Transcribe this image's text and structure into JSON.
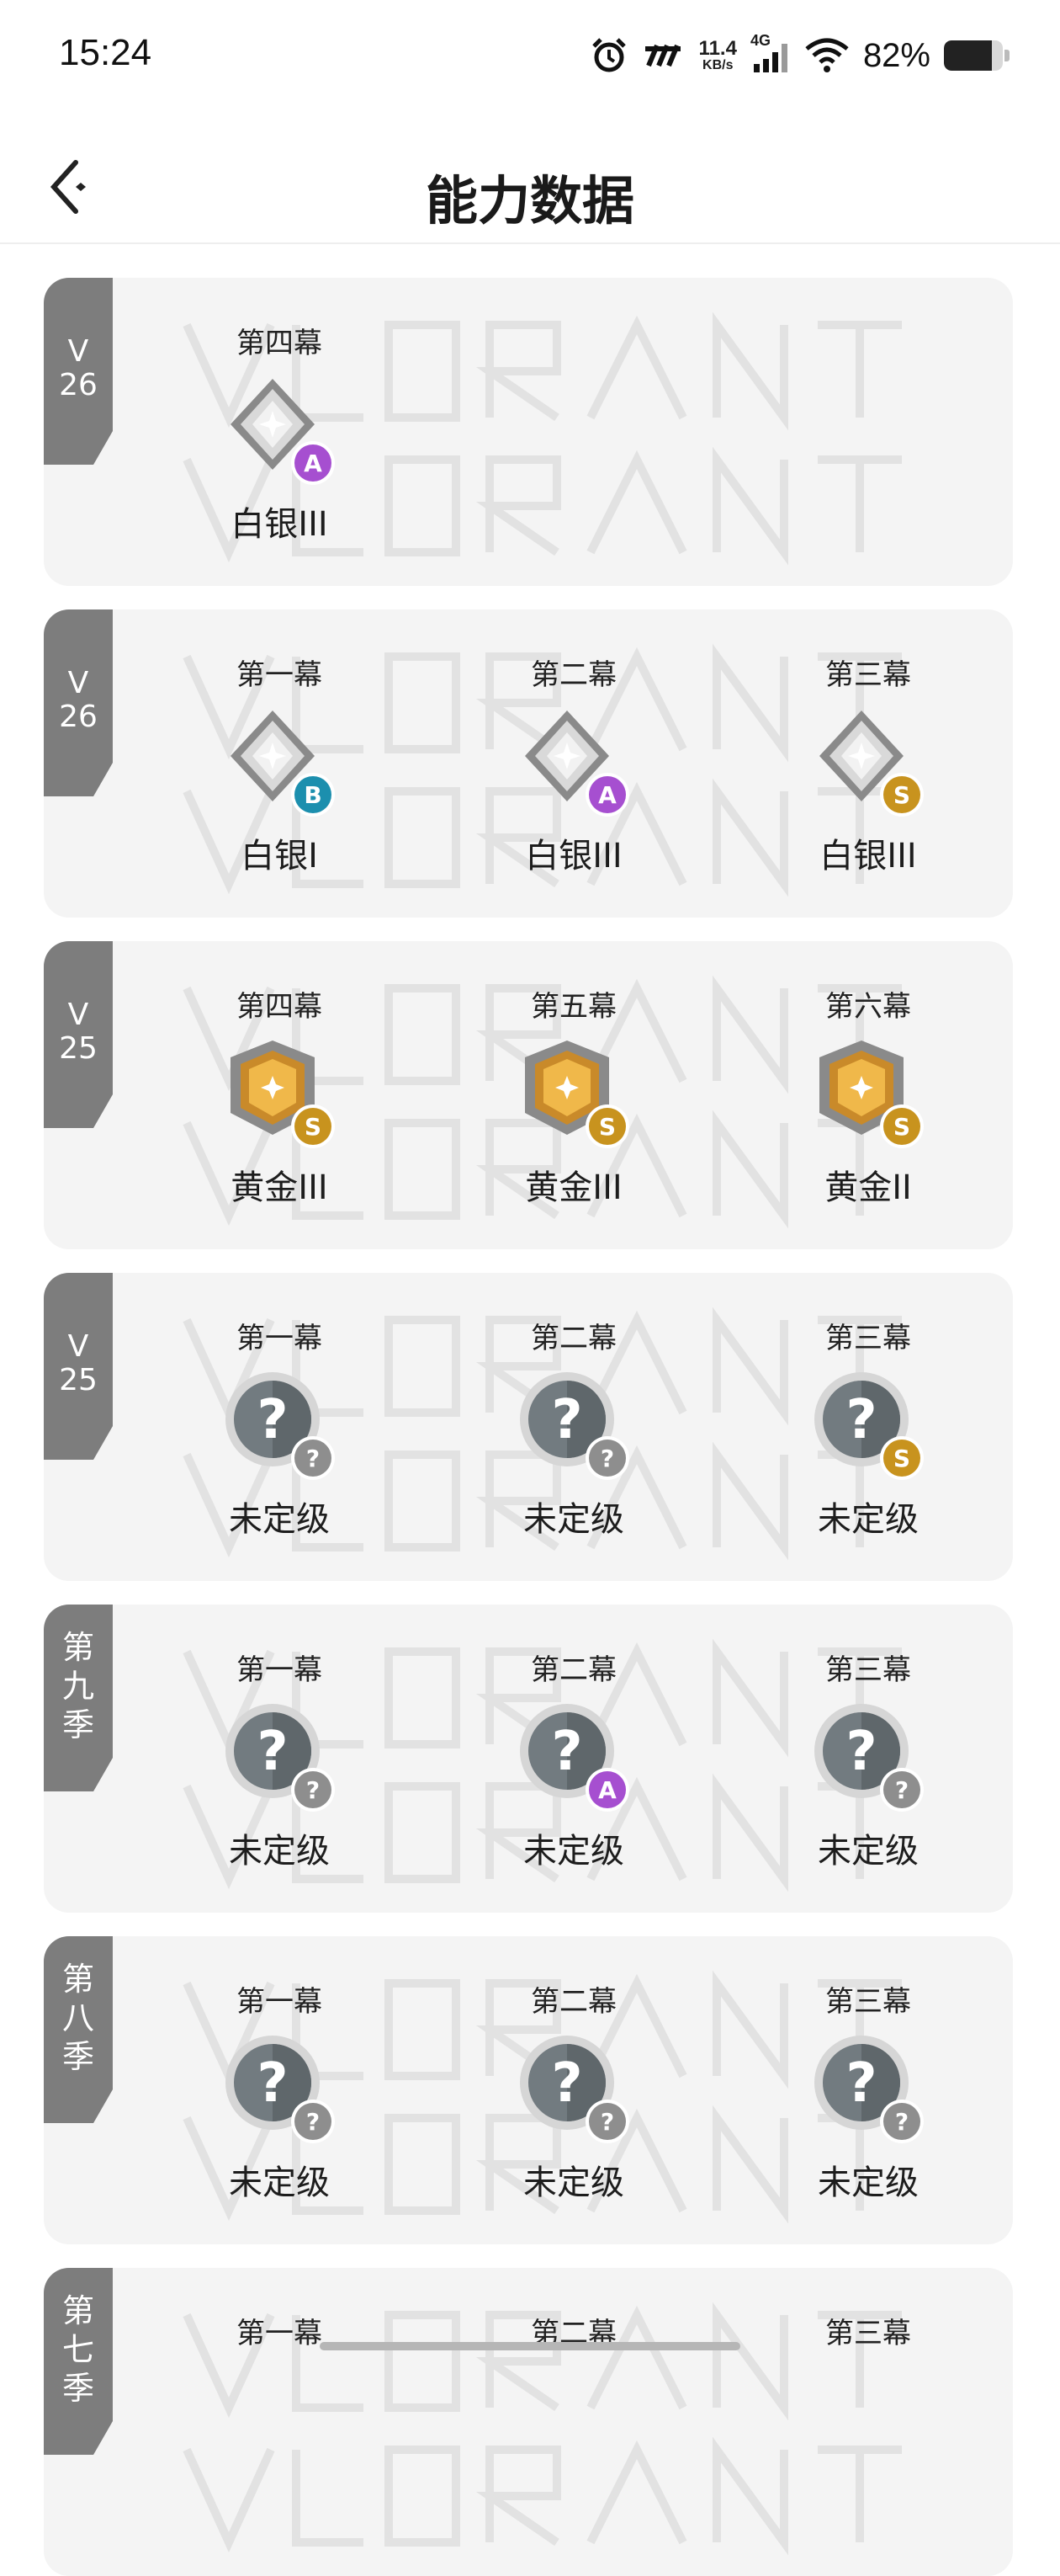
{
  "status_bar": {
    "time": "15:24",
    "network_speed": "11.4",
    "network_unit": "KB/s",
    "signal_label": "4G",
    "battery_percent": "82%",
    "battery_level": 0.82,
    "icons": [
      "alarm-icon",
      "app-notification-icon",
      "signal-icon",
      "wifi-icon",
      "battery-icon"
    ]
  },
  "header": {
    "title": "能力数据",
    "back_icon": "back-arrow-icon"
  },
  "colors": {
    "tag_bg": "#7d7d7d",
    "card_bg": "#f4f4f4",
    "badge_A": "#a64fd0",
    "badge_B": "#1c8fae",
    "badge_S": "#c8931e",
    "badge_unknown": "#8e8e8e",
    "silver": "#9a9a9a",
    "gold": "#e1a23a",
    "unranked": "#7a7a7a"
  },
  "seasons": [
    {
      "label": "V\n26",
      "acts": [
        {
          "act": "第四幕",
          "rank": "白银III",
          "tier": "silver",
          "grade": "A"
        }
      ]
    },
    {
      "label": "V\n26",
      "acts": [
        {
          "act": "第一幕",
          "rank": "白银I",
          "tier": "silver",
          "grade": "B"
        },
        {
          "act": "第二幕",
          "rank": "白银III",
          "tier": "silver",
          "grade": "A"
        },
        {
          "act": "第三幕",
          "rank": "白银III",
          "tier": "silver",
          "grade": "S"
        }
      ]
    },
    {
      "label": "V\n25",
      "acts": [
        {
          "act": "第四幕",
          "rank": "黄金III",
          "tier": "gold",
          "grade": "S"
        },
        {
          "act": "第五幕",
          "rank": "黄金III",
          "tier": "gold",
          "grade": "S"
        },
        {
          "act": "第六幕",
          "rank": "黄金II",
          "tier": "gold",
          "grade": "S"
        }
      ]
    },
    {
      "label": "V\n25",
      "acts": [
        {
          "act": "第一幕",
          "rank": "未定级",
          "tier": "unranked",
          "grade": "?"
        },
        {
          "act": "第二幕",
          "rank": "未定级",
          "tier": "unranked",
          "grade": "?"
        },
        {
          "act": "第三幕",
          "rank": "未定级",
          "tier": "unranked",
          "grade": "S"
        }
      ]
    },
    {
      "label": "第\n九\n季",
      "acts": [
        {
          "act": "第一幕",
          "rank": "未定级",
          "tier": "unranked",
          "grade": "?"
        },
        {
          "act": "第二幕",
          "rank": "未定级",
          "tier": "unranked",
          "grade": "A"
        },
        {
          "act": "第三幕",
          "rank": "未定级",
          "tier": "unranked",
          "grade": "?"
        }
      ]
    },
    {
      "label": "第\n八\n季",
      "acts": [
        {
          "act": "第一幕",
          "rank": "未定级",
          "tier": "unranked",
          "grade": "?"
        },
        {
          "act": "第二幕",
          "rank": "未定级",
          "tier": "unranked",
          "grade": "?"
        },
        {
          "act": "第三幕",
          "rank": "未定级",
          "tier": "unranked",
          "grade": "?"
        }
      ]
    },
    {
      "label": "第\n七\n季",
      "acts": [
        {
          "act": "第一幕"
        },
        {
          "act": "第二幕"
        },
        {
          "act": "第三幕"
        }
      ]
    }
  ]
}
